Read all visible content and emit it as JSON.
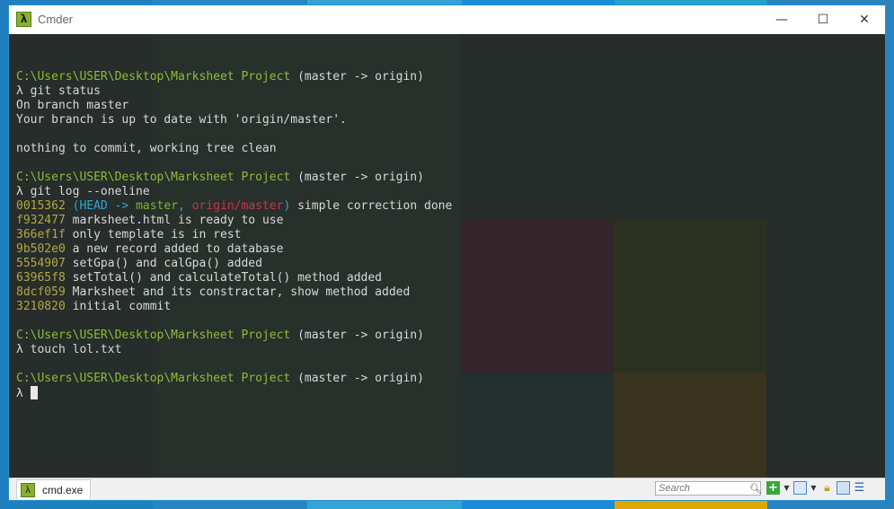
{
  "window": {
    "title": "Cmder",
    "app_icon_glyph": "λ",
    "controls": {
      "minimize": "—",
      "maximize": "☐",
      "close": "✕"
    }
  },
  "terminal": {
    "lines": [
      {
        "segments": []
      },
      {
        "segments": [
          {
            "text": "C:\\Users\\USER\\Desktop\\Marksheet Project",
            "cls": "path"
          },
          {
            "text": " (master -> origin)",
            "cls": ""
          }
        ]
      },
      {
        "segments": [
          {
            "text": "λ",
            "cls": "lam"
          },
          {
            "text": " git status",
            "cls": ""
          }
        ]
      },
      {
        "segments": [
          {
            "text": "On branch master",
            "cls": ""
          }
        ]
      },
      {
        "segments": [
          {
            "text": "Your branch is up to date with 'origin/master'.",
            "cls": ""
          }
        ]
      },
      {
        "segments": []
      },
      {
        "segments": [
          {
            "text": "nothing to commit, working tree clean",
            "cls": ""
          }
        ]
      },
      {
        "segments": []
      },
      {
        "segments": [
          {
            "text": "C:\\Users\\USER\\Desktop\\Marksheet Project",
            "cls": "path"
          },
          {
            "text": " (master -> origin)",
            "cls": ""
          }
        ]
      },
      {
        "segments": [
          {
            "text": "λ",
            "cls": "lam"
          },
          {
            "text": " git log --oneline",
            "cls": ""
          }
        ]
      },
      {
        "segments": [
          {
            "text": "0015362",
            "cls": "hash"
          },
          {
            "text": " (",
            "cls": "head"
          },
          {
            "text": "HEAD -> ",
            "cls": "head"
          },
          {
            "text": "master",
            "cls": "master"
          },
          {
            "text": ", ",
            "cls": "head"
          },
          {
            "text": "origin/master",
            "cls": "origmaster"
          },
          {
            "text": ")",
            "cls": "head"
          },
          {
            "text": " simple correction done",
            "cls": ""
          }
        ]
      },
      {
        "segments": [
          {
            "text": "f932477",
            "cls": "hash"
          },
          {
            "text": " marksheet.html is ready to use",
            "cls": ""
          }
        ]
      },
      {
        "segments": [
          {
            "text": "366ef1f",
            "cls": "hash"
          },
          {
            "text": " only template is in rest",
            "cls": ""
          }
        ]
      },
      {
        "segments": [
          {
            "text": "9b502e0",
            "cls": "hash"
          },
          {
            "text": " a new record added to database",
            "cls": ""
          }
        ]
      },
      {
        "segments": [
          {
            "text": "5554907",
            "cls": "hash"
          },
          {
            "text": " setGpa() and calGpa() added",
            "cls": ""
          }
        ]
      },
      {
        "segments": [
          {
            "text": "63965f8",
            "cls": "hash"
          },
          {
            "text": " setTotal() and calculateTotal() method added",
            "cls": ""
          }
        ]
      },
      {
        "segments": [
          {
            "text": "8dcf059",
            "cls": "hash"
          },
          {
            "text": " Marksheet and its constractar, show method added",
            "cls": ""
          }
        ]
      },
      {
        "segments": [
          {
            "text": "3210820",
            "cls": "hash"
          },
          {
            "text": " initial commit",
            "cls": ""
          }
        ]
      },
      {
        "segments": []
      },
      {
        "segments": [
          {
            "text": "C:\\Users\\USER\\Desktop\\Marksheet Project",
            "cls": "path"
          },
          {
            "text": " (master -> origin)",
            "cls": ""
          }
        ]
      },
      {
        "segments": [
          {
            "text": "λ",
            "cls": "lam"
          },
          {
            "text": " touch lol.txt",
            "cls": ""
          }
        ]
      },
      {
        "segments": []
      },
      {
        "segments": [
          {
            "text": "C:\\Users\\USER\\Desktop\\Marksheet Project",
            "cls": "path"
          },
          {
            "text": " (master -> origin)",
            "cls": ""
          }
        ]
      },
      {
        "segments": [
          {
            "text": "λ",
            "cls": "lam"
          },
          {
            "text": " ",
            "cls": ""
          }
        ],
        "cursor": true
      }
    ]
  },
  "statusbar": {
    "tab_label": "cmd.exe",
    "tab_icon_glyph": "λ",
    "search_placeholder": "Search",
    "icons": [
      "search-icon",
      "new-console-plus-icon",
      "dropdown-icon",
      "split-view-icon",
      "dropdown-icon",
      "lock-icon",
      "panel-icon",
      "menu-icon"
    ]
  },
  "colors": {
    "terminal_bg": "#262d2a",
    "path": "#8fbc3a",
    "hash": "#b8a642",
    "head": "#2ea8d8",
    "origin_master": "#d0304a",
    "branch_master": "#78b82a"
  }
}
